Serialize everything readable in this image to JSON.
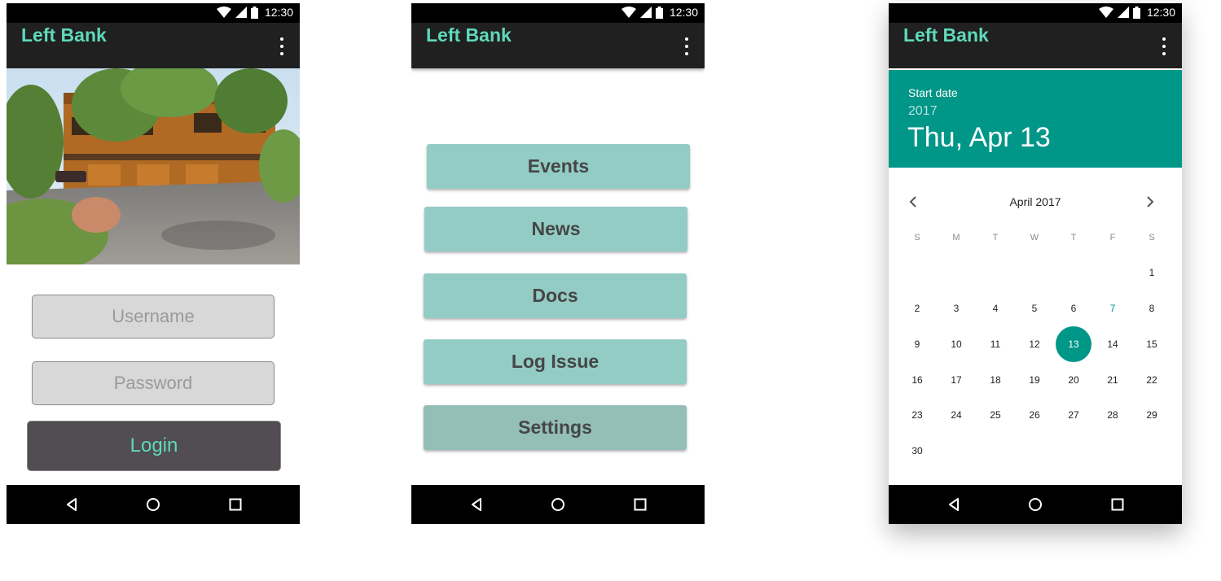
{
  "colors": {
    "accent_teal": "#5fd9bb",
    "header_teal": "#009688",
    "button_teal": "#93ccc5",
    "settings_teal": "#93bfb8",
    "login_bg": "#524c53",
    "appbar_bg": "#202020"
  },
  "status_bar": {
    "time": "12:30"
  },
  "app_bar": {
    "title": "Left Bank",
    "menu_icon": "more-vert-icon"
  },
  "nav_bar": {
    "icons": [
      "back-icon",
      "home-icon",
      "recents-icon"
    ]
  },
  "login_screen": {
    "hero_image": "building-photo",
    "username_placeholder": "Username",
    "password_placeholder": "Password",
    "login_label": "Login"
  },
  "home_screen": {
    "buttons": [
      {
        "label": "Events"
      },
      {
        "label": "News"
      },
      {
        "label": "Docs"
      },
      {
        "label": "Log Issue"
      },
      {
        "label": "Settings"
      }
    ]
  },
  "date_picker": {
    "label": "Start date",
    "year": "2017",
    "selected_date": "Thu, Apr 13",
    "month_label": "April 2017",
    "prev_icon": "chevron-left-icon",
    "next_icon": "chevron-right-icon",
    "weekdays": [
      "S",
      "M",
      "T",
      "W",
      "T",
      "F",
      "S"
    ],
    "first_weekday_index": 6,
    "days_in_month": 30,
    "today": 7,
    "selected": 13
  }
}
